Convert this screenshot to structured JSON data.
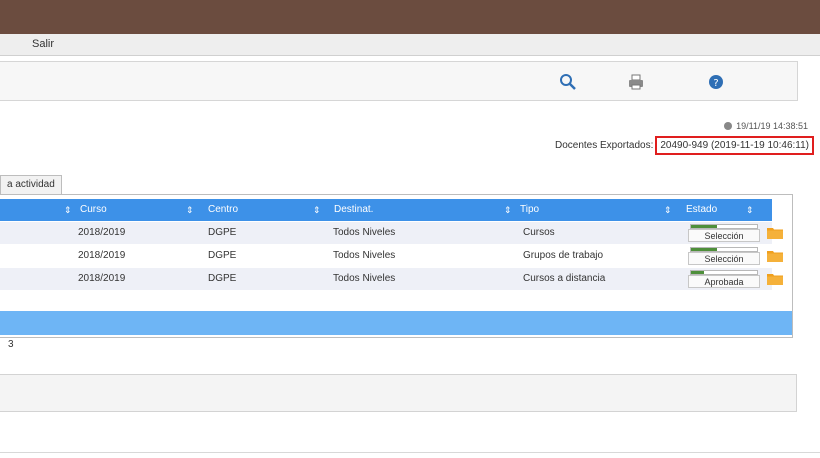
{
  "menu": {
    "item": "Salir"
  },
  "toolbar": {
    "icons": [
      "search-icon",
      "printer-icon",
      "help-icon"
    ]
  },
  "info": {
    "timestamp": "19/11/19 14:38:51",
    "export_label": "Docentes Exportados:",
    "export_value": "20490-949 (2019-11-19 10:46:11)"
  },
  "tab": {
    "label": "a actividad"
  },
  "grid": {
    "columns": [
      "Curso",
      "Centro",
      "Destinat.",
      "Tipo",
      "Estado"
    ],
    "rows": [
      {
        "curso": "2018/2019",
        "centro": "DGPE",
        "destinat": "Todos Niveles",
        "tipo": "Cursos",
        "estado": "Selección",
        "progress": 0.4
      },
      {
        "curso": "2018/2019",
        "centro": "DGPE",
        "destinat": "Todos Niveles",
        "tipo": "Grupos de trabajo",
        "estado": "Selección",
        "progress": 0.4
      },
      {
        "curso": "2018/2019",
        "centro": "DGPE",
        "destinat": "Todos Niveles",
        "tipo": "Cursos a distancia",
        "estado": "Aprobada",
        "progress": 0.2
      }
    ]
  },
  "pager": {
    "text": "3"
  },
  "colors": {
    "header": "#3d91e8",
    "footer": "#6eb5f5",
    "highlight": "#e01e1e",
    "progress": "#4e8f3a",
    "folder": "#f0a01e"
  }
}
